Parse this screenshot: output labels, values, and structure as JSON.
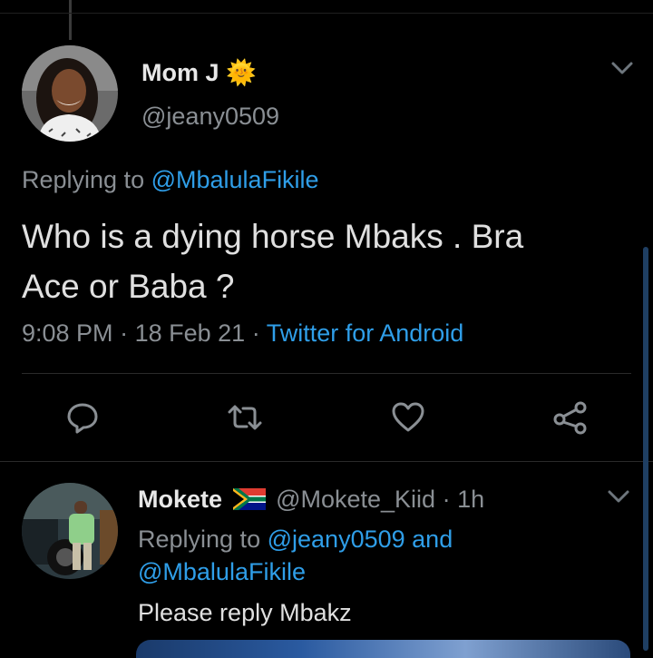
{
  "tweet": {
    "author_name": "Mom J",
    "author_emoji": "🌞",
    "author_handle": "@jeany0509",
    "replying_prefix": "Replying to",
    "replying_handle": "@MbalulaFikile",
    "text_line1": "Who is a dying horse Mbaks . Bra",
    "text_line2": "Ace or Baba ?",
    "time": "9:08 PM",
    "date": "18 Feb 21",
    "source": "Twitter for Android",
    "separator": "·"
  },
  "actions": [
    "reply-icon",
    "retweet-icon",
    "like-icon",
    "share-icon"
  ],
  "reply": {
    "author_name": "Mokete",
    "author_flag": "south-africa-flag-icon",
    "author_handle": "@Mokete_Kiid",
    "age": "1h",
    "separator": "·",
    "replying_prefix": "Replying to",
    "replying_handle1": "@jeany0509",
    "replying_and": "and",
    "replying_handle2": "@MbalulaFikile",
    "text": "Please reply Mbakz"
  },
  "colors": {
    "background": "#000000",
    "link": "#2f9ee8",
    "secondary_text": "#8a8f94"
  }
}
